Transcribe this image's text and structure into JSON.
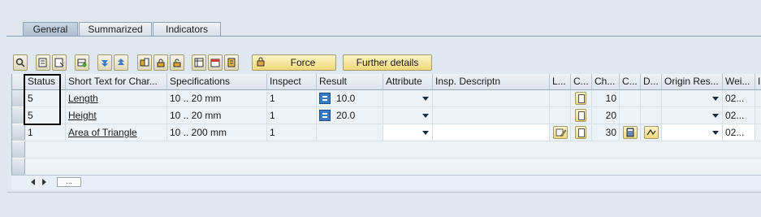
{
  "tabs": [
    {
      "label": "General"
    },
    {
      "label": "Summarized"
    },
    {
      "label": "Indicators"
    }
  ],
  "toolbar": {
    "icons": [
      "details-icon",
      "select-all-icon",
      "deselect-all-icon",
      "insert-row-icon",
      "sort-ascending-icon",
      "sort-descending-icon",
      "filter-icon",
      "lock-icon",
      "unlock-icon",
      "spreadsheet-icon",
      "calendar-icon",
      "print-icon"
    ],
    "force_label": "Force",
    "further_details_label": "Further details"
  },
  "grid": {
    "columns": [
      "Status",
      "Short Text for Char...",
      "Specifications",
      "Inspect",
      "Result",
      "Attribute",
      "Insp. Descriptn",
      "L...",
      "C...",
      "Ch...",
      "C...",
      "D...",
      "Origin Res...",
      "Wei...",
      "I"
    ],
    "rows": [
      {
        "status": "5",
        "short_text": "Length",
        "specifications": "10 .. 20 mm",
        "inspect": "1",
        "result": "10.0",
        "ch": "10",
        "weight": "02..."
      },
      {
        "status": "5",
        "short_text": "Height",
        "specifications": "10 .. 20 mm",
        "inspect": "1",
        "result": "20.0",
        "ch": "20",
        "weight": "02..."
      },
      {
        "status": "1",
        "short_text": "Area of Triangle",
        "specifications": "10 .. 200 mm",
        "inspect": "1",
        "result": "",
        "ch": "30",
        "weight": "02..."
      }
    ]
  },
  "scroll": {
    "handle_label": "..."
  }
}
